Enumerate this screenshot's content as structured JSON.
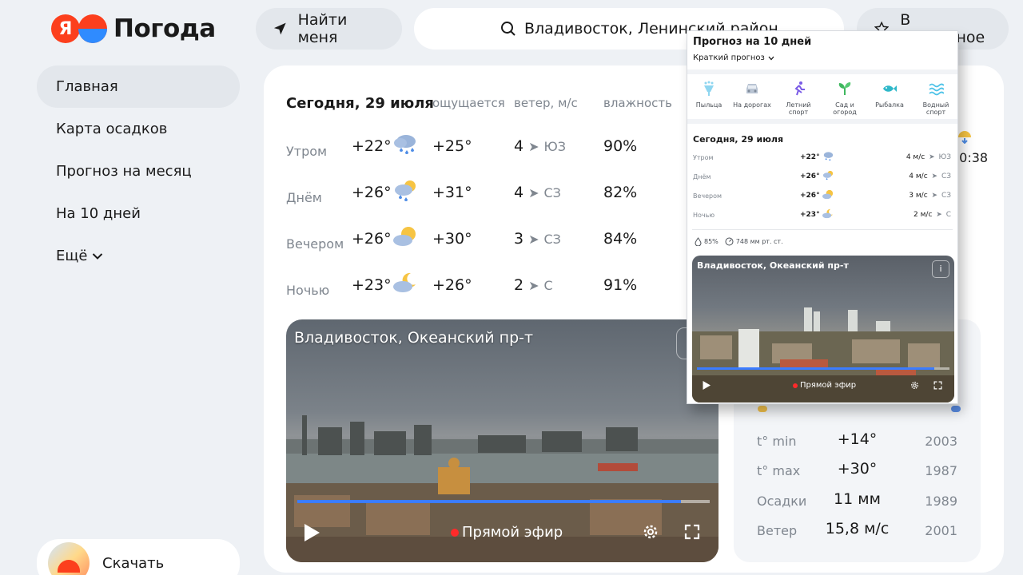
{
  "header": {
    "logo_letter": "Я",
    "logo_text": "Погода",
    "find_me_label": "Найти меня",
    "search_value": "Владивосток, Ленинский район",
    "favorite_label": "В избранное"
  },
  "sidebar": {
    "items": [
      {
        "label": "Главная",
        "active": true
      },
      {
        "label": "Карта осадков"
      },
      {
        "label": "Прогноз на месяц"
      },
      {
        "label": "На 10 дней"
      },
      {
        "label": "Ещё"
      }
    ],
    "download_label": "Скачать"
  },
  "forecast": {
    "title": "Сегодня, 29 июля",
    "col_feels": "ощущается",
    "col_wind": "ветер, м/с",
    "col_humidity": "влажность",
    "rows": [
      {
        "period": "Утром",
        "temp": "+22°",
        "icon": "rain-cloud-icon",
        "feels": "+25°",
        "wind": "4",
        "dir": "ЮЗ",
        "humidity": "90%"
      },
      {
        "period": "Днём",
        "temp": "+26°",
        "icon": "sun-cloud-rain-icon",
        "feels": "+31°",
        "wind": "4",
        "dir": "СЗ",
        "humidity": "82%"
      },
      {
        "period": "Вечером",
        "temp": "+26°",
        "icon": "sun-cloud-icon",
        "feels": "+30°",
        "wind": "3",
        "dir": "СЗ",
        "humidity": "84%"
      },
      {
        "period": "Ночью",
        "temp": "+23°",
        "icon": "moon-cloud-icon",
        "feels": "+26°",
        "wind": "2",
        "dir": "С",
        "humidity": "91%"
      }
    ],
    "sun_time": "20:38"
  },
  "video": {
    "title": "Владивосток, Океанский пр-т",
    "live_label": "Прямой эфир",
    "progress": 0.93
  },
  "climate": {
    "rows": [
      {
        "label": "t° min",
        "value": "+14°",
        "year": "2003"
      },
      {
        "label": "t° max",
        "value": "+30°",
        "year": "1987"
      },
      {
        "label": "Осадки",
        "value": "11 мм",
        "year": "1989"
      },
      {
        "label": "Ветер",
        "value": "15,8 м/с",
        "year": "2001"
      }
    ]
  },
  "popup": {
    "title": "Прогноз на 10 дней",
    "subtitle": "Краткий прогноз",
    "categories": [
      {
        "label": "Пыльца",
        "icon": "pollen-icon"
      },
      {
        "label": "На дорогах",
        "icon": "car-icon"
      },
      {
        "label": "Летний спорт",
        "icon": "runner-icon"
      },
      {
        "label": "Сад и огород",
        "icon": "sprout-icon"
      },
      {
        "label": "Рыбалка",
        "icon": "fish-icon"
      },
      {
        "label": "Водный спорт",
        "icon": "waves-icon"
      }
    ],
    "today_title": "Сегодня, 29 июля",
    "rows": [
      {
        "period": "Утром",
        "temp": "+22°",
        "wind": "4 м/с",
        "dir": "ЮЗ"
      },
      {
        "period": "Днём",
        "temp": "+26°",
        "wind": "4 м/с",
        "dir": "СЗ"
      },
      {
        "period": "Вечером",
        "temp": "+26°",
        "wind": "3 м/с",
        "dir": "СЗ"
      },
      {
        "period": "Ночью",
        "temp": "+23°",
        "wind": "2 м/с",
        "dir": "С"
      }
    ],
    "humidity": "85%",
    "pressure": "748 мм рт. ст.",
    "video_title": "Владивосток, Океанский пр-т",
    "live_label": "Прямой эфир",
    "video_progress": 0.94
  },
  "colors": {
    "brand_red": "#fc3f1d",
    "accent_blue": "#3b7cff",
    "background": "#eef1f5"
  }
}
